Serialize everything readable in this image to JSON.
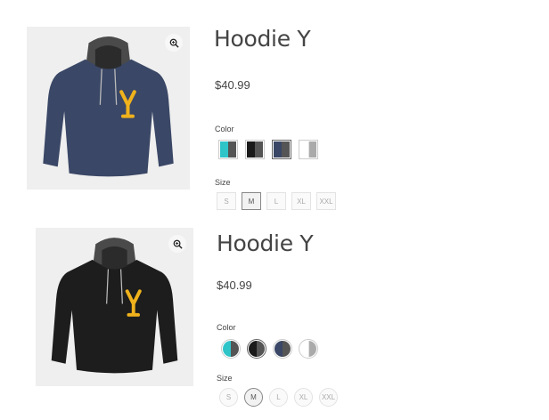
{
  "products": [
    {
      "title": "Hoodie Y",
      "price": "$40.99",
      "color_label": "Color",
      "size_label": "Size",
      "body_color": "#3a4766",
      "hood_color": "#4a4a4a",
      "logo_color": "#f0b21c",
      "colors": [
        {
          "name": "turquoise-gray",
          "left": "#2fc4c8",
          "right": "#555555",
          "selected": false
        },
        {
          "name": "black-gray",
          "left": "#1a1a1a",
          "right": "#555555",
          "selected": false
        },
        {
          "name": "navy-gray",
          "left": "#3a4766",
          "right": "#555555",
          "selected": true
        },
        {
          "name": "white-gray",
          "left": "#ffffff",
          "right": "#aaaaaa",
          "selected": false
        }
      ],
      "sizes": [
        {
          "label": "S",
          "selected": false
        },
        {
          "label": "M",
          "selected": true
        },
        {
          "label": "L",
          "selected": false
        },
        {
          "label": "XL",
          "selected": false
        },
        {
          "label": "XXL",
          "selected": false
        }
      ]
    },
    {
      "title": "Hoodie Y",
      "price": "$40.99",
      "color_label": "Color",
      "size_label": "Size",
      "body_color": "#1d1d1d",
      "hood_color": "#4a4a4a",
      "logo_color": "#f0b21c",
      "colors": [
        {
          "name": "turquoise-gray",
          "left": "#2fc4c8",
          "right": "#555555",
          "selected": false
        },
        {
          "name": "black-gray",
          "left": "#1a1a1a",
          "right": "#555555",
          "selected": true
        },
        {
          "name": "navy-gray",
          "left": "#3a4766",
          "right": "#555555",
          "selected": false
        },
        {
          "name": "white-gray",
          "left": "#ffffff",
          "right": "#aaaaaa",
          "selected": false
        }
      ],
      "sizes": [
        {
          "label": "S",
          "selected": false
        },
        {
          "label": "M",
          "selected": true
        },
        {
          "label": "L",
          "selected": false
        },
        {
          "label": "XL",
          "selected": false
        },
        {
          "label": "XXL",
          "selected": false
        }
      ]
    }
  ]
}
